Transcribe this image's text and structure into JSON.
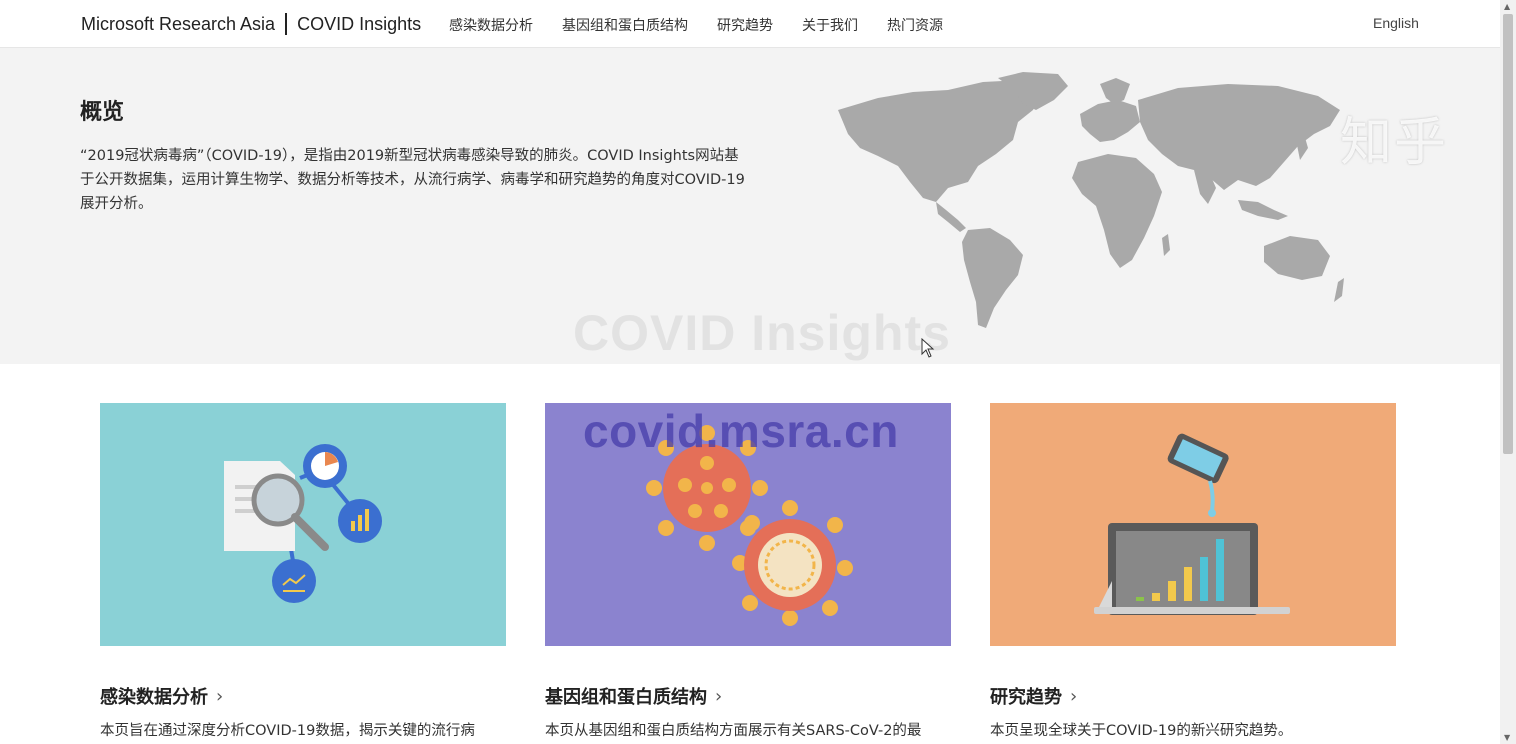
{
  "header": {
    "brand_left": "Microsoft Research Asia",
    "brand_right": "COVID Insights",
    "nav": [
      {
        "label": "感染数据分析"
      },
      {
        "label": "基因组和蛋白质结构"
      },
      {
        "label": "研究趋势"
      },
      {
        "label": "关于我们"
      },
      {
        "label": "热门资源"
      }
    ],
    "language": "English"
  },
  "hero": {
    "title": "概览",
    "description": "“2019冠状病毒病”（COVID-19），是指由2019新型冠状病毒感染导致的肺炎。COVID Insights网站基于公开数据集，运用计算生物学、数据分析等技术，从流行病学、病毒学和研究趋势的角度对COVID-19展开分析。",
    "watermark": "COVID Insights",
    "zhihu_watermark": "知乎"
  },
  "url_watermark": "covid.msra.cn",
  "cards": [
    {
      "title": "感染数据分析",
      "description": "本页旨在通过深度分析COVID-19数据，揭示关键的流行病",
      "color": "#8ad1d6"
    },
    {
      "title": "基因组和蛋白质结构",
      "description": "本页从基因组和蛋白质结构方面展示有关SARS-CoV-2的最",
      "color": "#8b83cf"
    },
    {
      "title": "研究趋势",
      "description": "本页呈现全球关于COVID-19的新兴研究趋势。",
      "color": "#f0aa78"
    }
  ],
  "icons": {
    "chevron": "chevron-right-icon",
    "map": "world-map-illustration"
  }
}
